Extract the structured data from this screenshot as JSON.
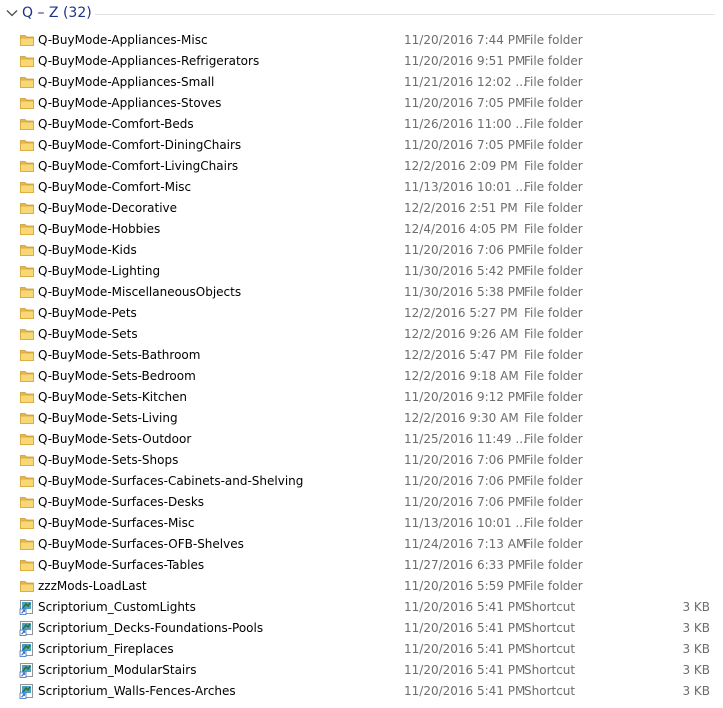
{
  "group": {
    "title": "Q – Z (32)"
  },
  "icons": {
    "folder": "folder-icon",
    "shortcut": "shortcut-icon"
  },
  "colors": {
    "group_title": "#1e3287",
    "meta_text": "#6d6d6d",
    "folder_fill": "#f8d775"
  },
  "files": [
    {
      "name": "Q-BuyMode-Appliances-Misc",
      "date": "11/20/2016 7:44 PM",
      "type": "File folder",
      "size": "",
      "kind": "folder"
    },
    {
      "name": "Q-BuyMode-Appliances-Refrigerators",
      "date": "11/20/2016 9:51 PM",
      "type": "File folder",
      "size": "",
      "kind": "folder"
    },
    {
      "name": "Q-BuyMode-Appliances-Small",
      "date": "11/21/2016 12:02 ...",
      "type": "File folder",
      "size": "",
      "kind": "folder"
    },
    {
      "name": "Q-BuyMode-Appliances-Stoves",
      "date": "11/20/2016 7:05 PM",
      "type": "File folder",
      "size": "",
      "kind": "folder"
    },
    {
      "name": "Q-BuyMode-Comfort-Beds",
      "date": "11/26/2016 11:00 ...",
      "type": "File folder",
      "size": "",
      "kind": "folder"
    },
    {
      "name": "Q-BuyMode-Comfort-DiningChairs",
      "date": "11/20/2016 7:05 PM",
      "type": "File folder",
      "size": "",
      "kind": "folder"
    },
    {
      "name": "Q-BuyMode-Comfort-LivingChairs",
      "date": "12/2/2016 2:09 PM",
      "type": "File folder",
      "size": "",
      "kind": "folder"
    },
    {
      "name": "Q-BuyMode-Comfort-Misc",
      "date": "11/13/2016 10:01 ...",
      "type": "File folder",
      "size": "",
      "kind": "folder"
    },
    {
      "name": "Q-BuyMode-Decorative",
      "date": "12/2/2016 2:51 PM",
      "type": "File folder",
      "size": "",
      "kind": "folder"
    },
    {
      "name": "Q-BuyMode-Hobbies",
      "date": "12/4/2016 4:05 PM",
      "type": "File folder",
      "size": "",
      "kind": "folder"
    },
    {
      "name": "Q-BuyMode-Kids",
      "date": "11/20/2016 7:06 PM",
      "type": "File folder",
      "size": "",
      "kind": "folder"
    },
    {
      "name": "Q-BuyMode-Lighting",
      "date": "11/30/2016 5:42 PM",
      "type": "File folder",
      "size": "",
      "kind": "folder"
    },
    {
      "name": "Q-BuyMode-MiscellaneousObjects",
      "date": "11/30/2016 5:38 PM",
      "type": "File folder",
      "size": "",
      "kind": "folder"
    },
    {
      "name": "Q-BuyMode-Pets",
      "date": "12/2/2016 5:27 PM",
      "type": "File folder",
      "size": "",
      "kind": "folder"
    },
    {
      "name": "Q-BuyMode-Sets",
      "date": "12/2/2016 9:26 AM",
      "type": "File folder",
      "size": "",
      "kind": "folder"
    },
    {
      "name": "Q-BuyMode-Sets-Bathroom",
      "date": "12/2/2016 5:47 PM",
      "type": "File folder",
      "size": "",
      "kind": "folder"
    },
    {
      "name": "Q-BuyMode-Sets-Bedroom",
      "date": "12/2/2016 9:18 AM",
      "type": "File folder",
      "size": "",
      "kind": "folder"
    },
    {
      "name": "Q-BuyMode-Sets-Kitchen",
      "date": "11/20/2016 9:12 PM",
      "type": "File folder",
      "size": "",
      "kind": "folder"
    },
    {
      "name": "Q-BuyMode-Sets-Living",
      "date": "12/2/2016 9:30 AM",
      "type": "File folder",
      "size": "",
      "kind": "folder"
    },
    {
      "name": "Q-BuyMode-Sets-Outdoor",
      "date": "11/25/2016 11:49 ...",
      "type": "File folder",
      "size": "",
      "kind": "folder"
    },
    {
      "name": "Q-BuyMode-Sets-Shops",
      "date": "11/20/2016 7:06 PM",
      "type": "File folder",
      "size": "",
      "kind": "folder"
    },
    {
      "name": "Q-BuyMode-Surfaces-Cabinets-and-Shelving",
      "date": "11/20/2016 7:06 PM",
      "type": "File folder",
      "size": "",
      "kind": "folder"
    },
    {
      "name": "Q-BuyMode-Surfaces-Desks",
      "date": "11/20/2016 7:06 PM",
      "type": "File folder",
      "size": "",
      "kind": "folder"
    },
    {
      "name": "Q-BuyMode-Surfaces-Misc",
      "date": "11/13/2016 10:01 ...",
      "type": "File folder",
      "size": "",
      "kind": "folder"
    },
    {
      "name": "Q-BuyMode-Surfaces-OFB-Shelves",
      "date": "11/24/2016 7:13 AM",
      "type": "File folder",
      "size": "",
      "kind": "folder"
    },
    {
      "name": "Q-BuyMode-Surfaces-Tables",
      "date": "11/27/2016 6:33 PM",
      "type": "File folder",
      "size": "",
      "kind": "folder"
    },
    {
      "name": "zzzMods-LoadLast",
      "date": "11/20/2016 5:59 PM",
      "type": "File folder",
      "size": "",
      "kind": "folder"
    },
    {
      "name": "Scriptorium_CustomLights",
      "date": "11/20/2016 5:41 PM",
      "type": "Shortcut",
      "size": "3 KB",
      "kind": "shortcut"
    },
    {
      "name": "Scriptorium_Decks-Foundations-Pools",
      "date": "11/20/2016 5:41 PM",
      "type": "Shortcut",
      "size": "3 KB",
      "kind": "shortcut"
    },
    {
      "name": "Scriptorium_Fireplaces",
      "date": "11/20/2016 5:41 PM",
      "type": "Shortcut",
      "size": "3 KB",
      "kind": "shortcut"
    },
    {
      "name": "Scriptorium_ModularStairs",
      "date": "11/20/2016 5:41 PM",
      "type": "Shortcut",
      "size": "3 KB",
      "kind": "shortcut"
    },
    {
      "name": "Scriptorium_Walls-Fences-Arches",
      "date": "11/20/2016 5:41 PM",
      "type": "Shortcut",
      "size": "3 KB",
      "kind": "shortcut"
    }
  ]
}
